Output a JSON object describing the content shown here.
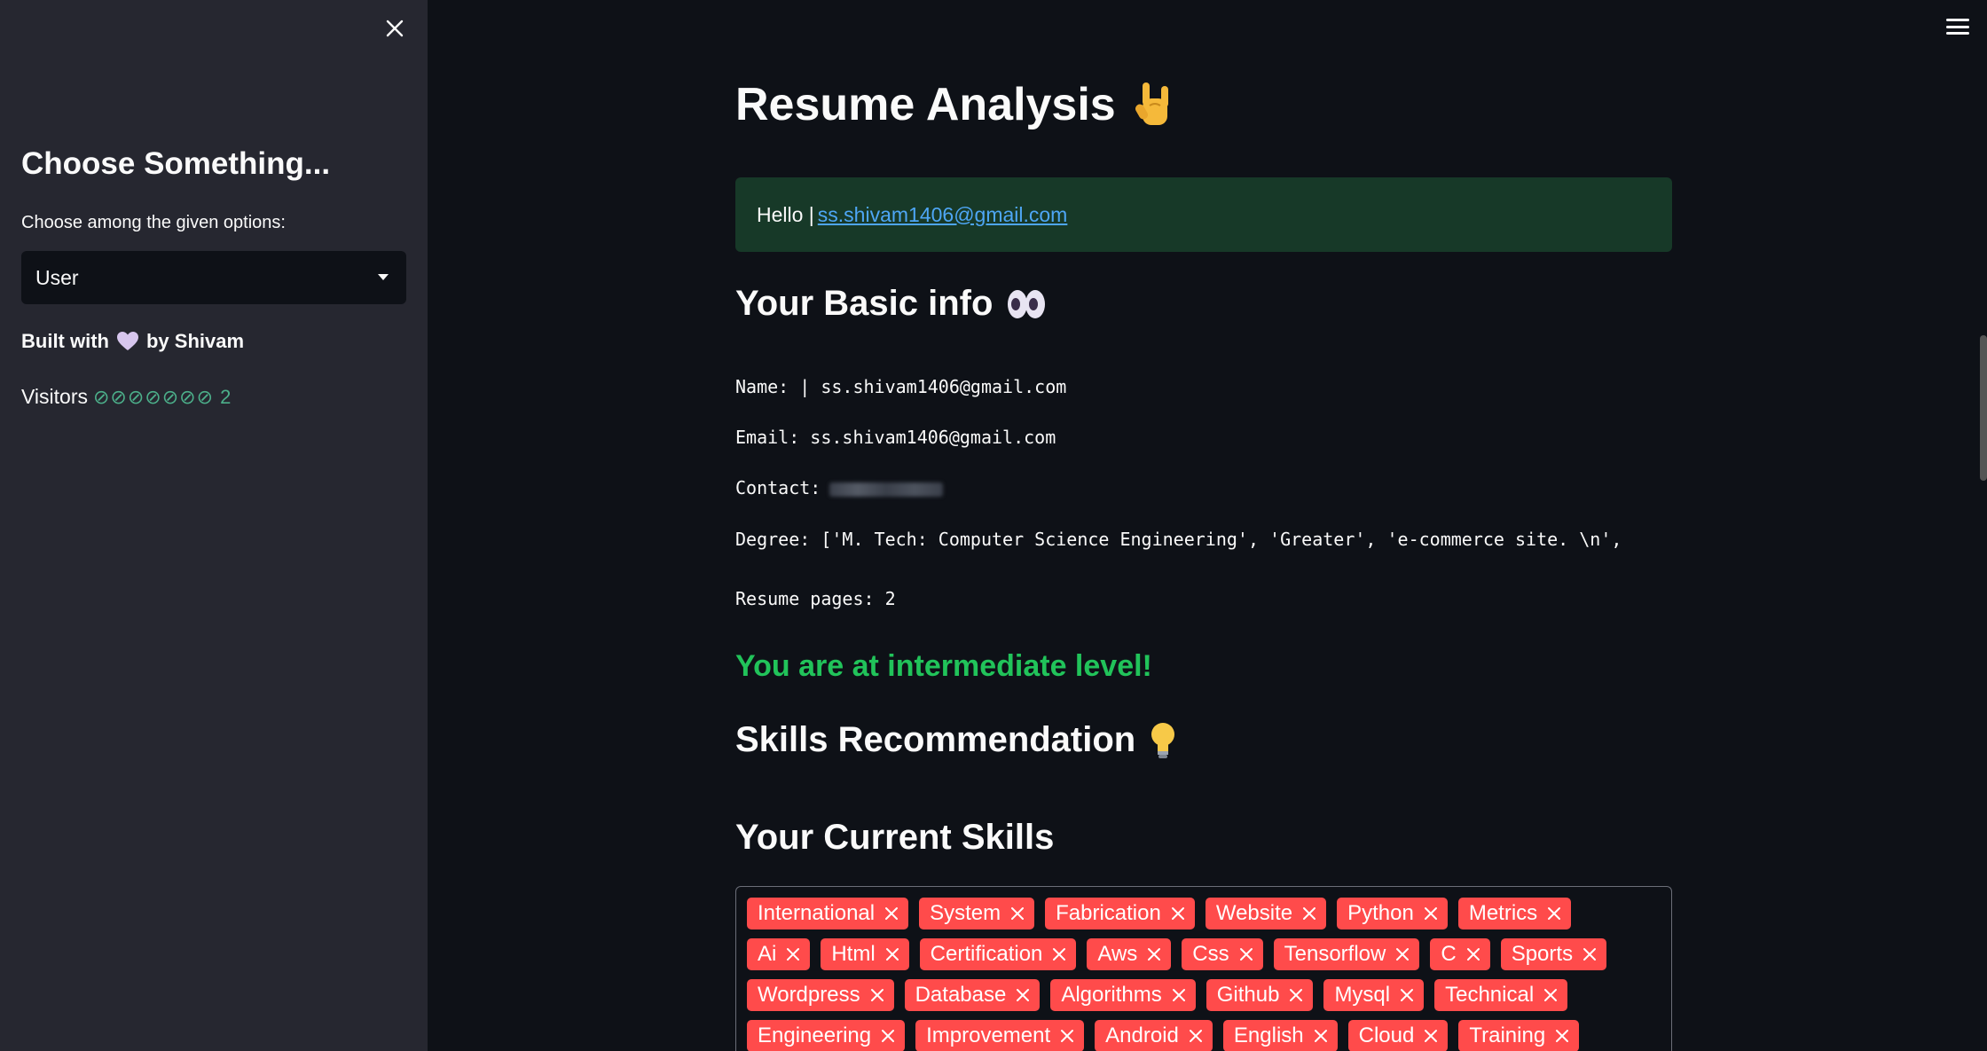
{
  "sidebar": {
    "heading": "Choose Something...",
    "select_label": "Choose among the given options:",
    "select_value": "User",
    "built_prefix": "Built with",
    "built_suffix": "by Shivam",
    "visitors_label": "Visitors",
    "visitors_count": "⊘⊘⊘⊘⊘⊘⊘ 2"
  },
  "main": {
    "title": "Resume Analysis",
    "hello_prefix": "Hello |",
    "hello_email": "ss.shivam1406@gmail.com",
    "basic_info_heading": "Your Basic info",
    "name_line": "Name: | ss.shivam1406@gmail.com",
    "email_line": "Email: ss.shivam1406@gmail.com",
    "contact_label": "Contact:",
    "degree_line": "Degree: ['M. Tech: Computer Science Engineering', 'Greater', 'e-commerce site. \\n',",
    "pages_line": "Resume pages: 2",
    "level_text": "You are at intermediate level!",
    "skills_rec_heading": "Skills Recommendation",
    "current_skills_heading": "Your Current Skills",
    "skills_rows": [
      [
        "International",
        "System",
        "Fabrication",
        "Website",
        "Python",
        "Metrics"
      ],
      [
        "Ai",
        "Html",
        "Certification",
        "Aws",
        "Css",
        "Tensorflow",
        "C",
        "Sports"
      ],
      [
        "Wordpress",
        "Database",
        "Algorithms",
        "Github",
        "Mysql",
        "Technical"
      ],
      [
        "Engineering",
        "Improvement",
        "Android",
        "English",
        "Cloud",
        "Training"
      ]
    ]
  },
  "colors": {
    "sidebar_bg": "#262730",
    "main_bg": "#0e1117",
    "success_bg": "#173928",
    "level_green": "#21c35a",
    "tag_red": "#ff4b4b",
    "link_blue": "#4ea6f5"
  },
  "icons": {
    "close": "close-icon",
    "menu": "hamburger-menu-icon",
    "select_caret": "caret-down-icon",
    "heart": "heart-icon",
    "title_emoji": "rock-on-hand-icon",
    "eyes": "eyes-icon",
    "bulb": "lightbulb-icon",
    "tag_remove": "remove-x-icon"
  }
}
